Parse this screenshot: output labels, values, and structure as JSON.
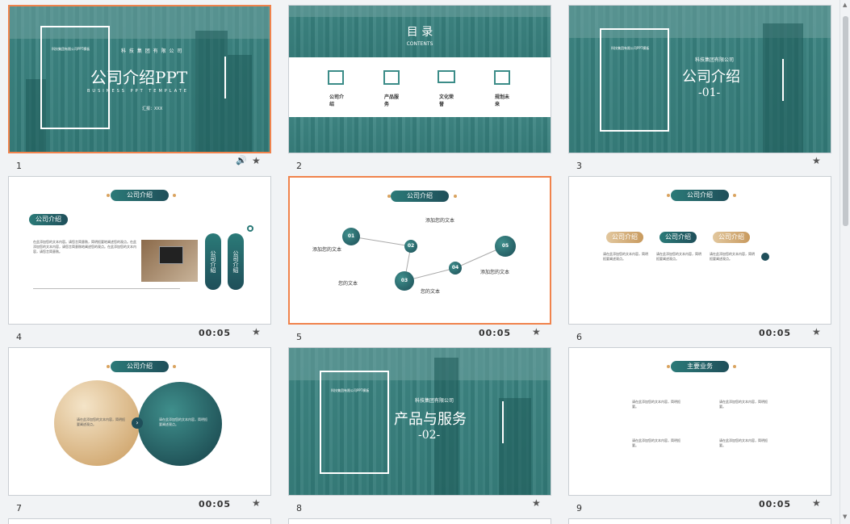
{
  "slides": [
    {
      "num": "1",
      "title": "公司介绍PPT",
      "subtitle": "BUSINESS PPT TEMPLATE",
      "company": "科 技 集 团 有 限 公 司",
      "reporter": "汇报：XXX",
      "small_top": "科技集团有限公司PPT模板",
      "sound": true
    },
    {
      "num": "2",
      "title": "目 录",
      "subtitle": "CONTENTS",
      "items": [
        "公司介绍",
        "产品服务",
        "文化荣誉",
        "规划未来"
      ]
    },
    {
      "num": "3",
      "title": "公司介绍",
      "section": "-01-",
      "company": "科技集团有限公司",
      "small_top": "科技集团有限公司PPT模板"
    },
    {
      "num": "4",
      "pill": "公司介绍",
      "sub_pill": "公司介绍",
      "side_tags": [
        "公司介绍",
        "公司介绍"
      ],
      "duration": "00:05"
    },
    {
      "num": "5",
      "pill": "公司介绍",
      "nodes": [
        "01",
        "02",
        "03",
        "04",
        "05"
      ],
      "labels": [
        "添加您的文本",
        "添加您的文本",
        "您的文本",
        "您的文本",
        "添加您的文本"
      ],
      "duration": "00:05"
    },
    {
      "num": "6",
      "pill": "公司介绍",
      "tags": [
        "公司介绍",
        "公司介绍",
        "公司介绍"
      ],
      "duration": "00:05"
    },
    {
      "num": "7",
      "pill": "公司介绍",
      "duration": "00:05"
    },
    {
      "num": "8",
      "title": "产品与服务",
      "section": "-02-",
      "company": "科技集团有限公司",
      "small_top": "科技集团有限公司PPT模板"
    },
    {
      "num": "9",
      "pill": "主要业务",
      "duration": "00:05"
    }
  ],
  "colors": {
    "accent": "#2b7a78",
    "dark": "#1f4f5a",
    "gold": "#c89a5e",
    "selected": "#f0834c"
  },
  "icons": {
    "sound": "speaker-icon",
    "transition": "star-icon"
  }
}
